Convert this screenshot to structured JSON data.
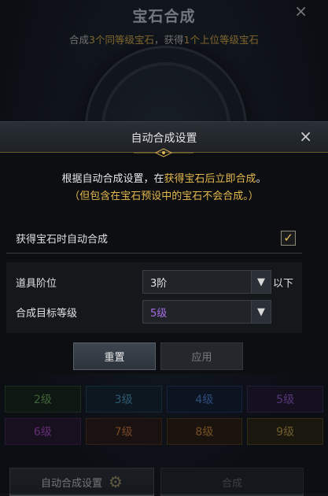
{
  "background_window": {
    "title": "宝石合成",
    "close_icon": "×",
    "subtitle_parts": [
      "合成",
      "3个同等级宝石",
      "，获得",
      "1个上位等级宝石"
    ],
    "grades": [
      {
        "label": "2级",
        "color": "#6fae5a"
      },
      {
        "label": "3级",
        "color": "#4d9cc4"
      },
      {
        "label": "4级",
        "color": "#4f86d8"
      },
      {
        "label": "5级",
        "color": "#9c5fd4"
      },
      {
        "label": "6级",
        "color": "#b04fc8"
      },
      {
        "label": "7级",
        "color": "#d47b3b"
      },
      {
        "label": "8级",
        "color": "#d18a34"
      },
      {
        "label": "9级",
        "color": "#c9a449"
      }
    ],
    "auto_settings_button": "自动合成设置",
    "auto_settings_icon": "gear-icon",
    "compose_button": "合成"
  },
  "modal": {
    "title": "自动合成设置",
    "close_icon": "×",
    "notice_line1_a": "根据自动合成设置，在",
    "notice_line1_hl": "获得宝石后立即合成",
    "notice_line1_b": "。",
    "notice_line2": "（但包含在宝石预设中的宝石不会合成。）",
    "auto_compose_label": "获得宝石时自动合成",
    "auto_compose_checked": true,
    "item_tier_label": "道具阶位",
    "item_tier_value": "3阶",
    "item_tier_suffix": "以下",
    "target_grade_label": "合成目标等级",
    "target_grade_value": "5级",
    "reset_button": "重置",
    "apply_button": "应用"
  },
  "colors": {
    "accent_gold": "#e6b94e",
    "grade5_purple": "#a56ce0"
  }
}
